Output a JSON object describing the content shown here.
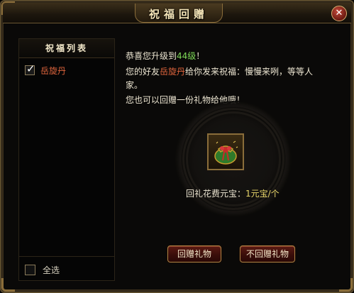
{
  "window": {
    "title": "祝福回赠"
  },
  "list": {
    "header": "祝福列表",
    "items": [
      {
        "label": "岳旋丹",
        "checked": true
      }
    ],
    "select_all_label": "全选",
    "select_all_checked": false
  },
  "message": {
    "line1_prefix": "恭喜您升级到",
    "level": "44级",
    "line1_suffix": "！",
    "line2_prefix": "您的好友",
    "friend_name": "岳旋丹",
    "line2_suffix": "给你发来祝福：慢慢来咧，等等人",
    "line3": "家。",
    "line4": "您也可以回赠一份礼物给他哦！"
  },
  "gift": {
    "icon": "lucky-bag-icon",
    "cost_prefix": "回礼花费元宝：",
    "cost_value": "1元宝/个"
  },
  "buttons": {
    "return_gift": "回赠礼物",
    "no_return_gift": "不回赠礼物"
  },
  "colors": {
    "accent_gold": "#8a6d3a",
    "highlight_green": "#7ed957",
    "highlight_orange": "#e0653d",
    "button_red": "#5a1a12"
  }
}
